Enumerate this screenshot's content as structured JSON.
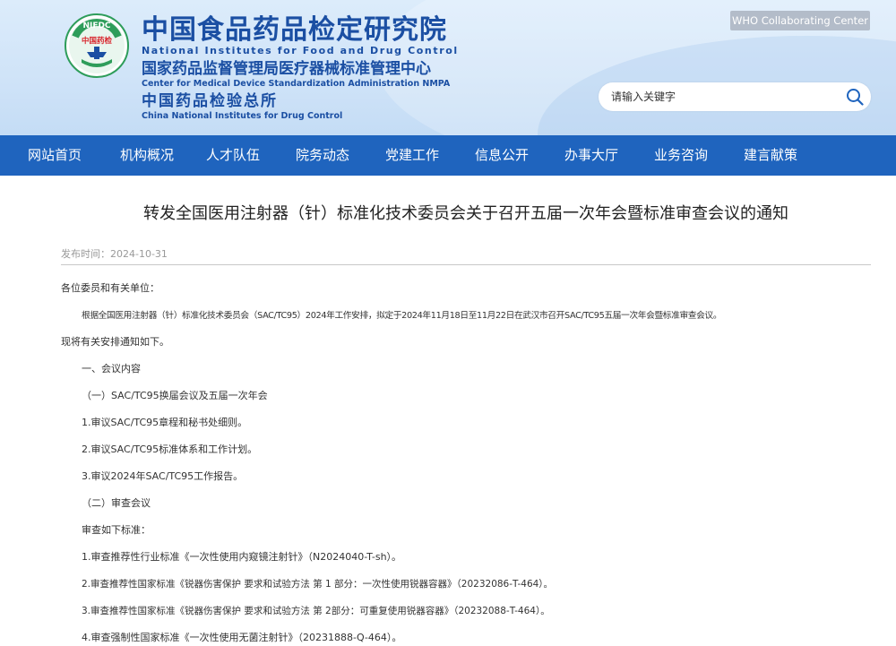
{
  "header": {
    "logo_text_top": "NIFDC",
    "logo_text_mid": "中国药检",
    "org_name_cn": "中国食品药品检定研究院",
    "org_name_en": "National Institutes for Food and Drug Control",
    "center_cn": "国家药品监督管理局医疗器械标准管理中心",
    "center_en": "Center for Medical Device Standardization Administration NMPA",
    "drug_cn": "中国药品检验总所",
    "drug_en": "China National Institutes for Drug Control",
    "who_button": "WHO Collaborating Center",
    "search_placeholder": "请输入关键字"
  },
  "nav": [
    "网站首页",
    "机构概况",
    "人才队伍",
    "院务动态",
    "党建工作",
    "信息公开",
    "办事大厅",
    "业务咨询",
    "建言献策"
  ],
  "article": {
    "title": "转发全国医用注射器（针）标准化技术委员会关于召开五届一次年会暨标准审查会议的通知",
    "publish_time": "发布时间：2024-10-31",
    "paragraphs": [
      "各位委员和有关单位：",
      "根据全国医用注射器（针）标准化技术委员会（SAC/TC95）2024年工作安排，拟定于2024年11月18日至11月22日在武汉市召开SAC/TC95五届一次年会暨标准审查会议。",
      "现将有关安排通知如下。",
      "一、会议内容",
      "（一）SAC/TC95换届会议及五届一次年会",
      "1.审议SAC/TC95章程和秘书处细则。",
      "2.审议SAC/TC95标准体系和工作计划。",
      "3.审议2024年SAC/TC95工作报告。",
      "（二）审查会议",
      "审查如下标准：",
      "1.审查推荐性行业标准《一次性使用内窥镜注射针》（N2024040-T-sh）。",
      "2.审查推荐性国家标准《锐器伤害保护 要求和试验方法 第 1 部分：一次性使用锐器容器》（20232086-T-464）。",
      "3.审查推荐性国家标准《锐器伤害保护 要求和试验方法 第 2部分：可重复使用锐器容器》（20232088-T-464）。",
      "4.审查强制性国家标准《一次性使用无菌注射针》（20231888-Q-464）。"
    ]
  }
}
